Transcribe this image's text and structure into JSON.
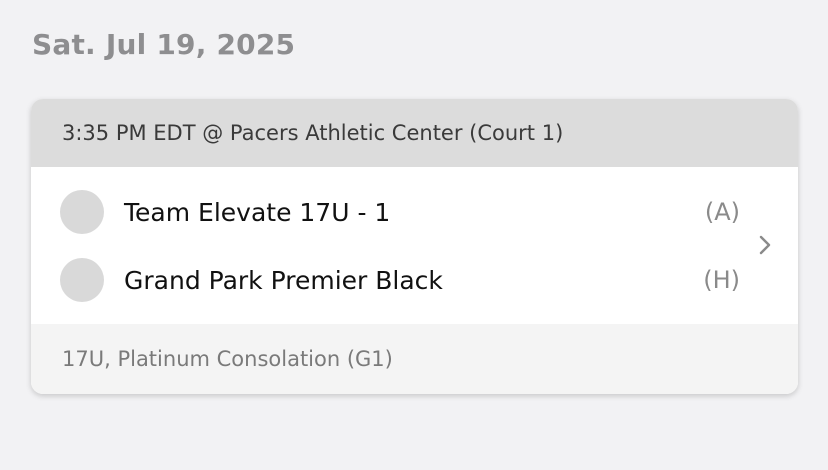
{
  "date_heading": "Sat. Jul 19, 2025",
  "game": {
    "header": "3:35 PM EDT @ Pacers Athletic Center (Court 1)",
    "teams": [
      {
        "name": "Team Elevate 17U - 1",
        "side": "(A)"
      },
      {
        "name": "Grand Park Premier Black",
        "side": "(H)"
      }
    ],
    "footer": "17U, Platinum Consolation (G1)"
  },
  "icons": {
    "chevron": "chevron-right-icon",
    "team_logo": "team-logo-placeholder"
  },
  "colors": {
    "background": "#f2f2f4",
    "header_bg": "#dcdcdc",
    "footer_bg": "#f4f4f4",
    "logo_placeholder": "#d9d9d9"
  }
}
